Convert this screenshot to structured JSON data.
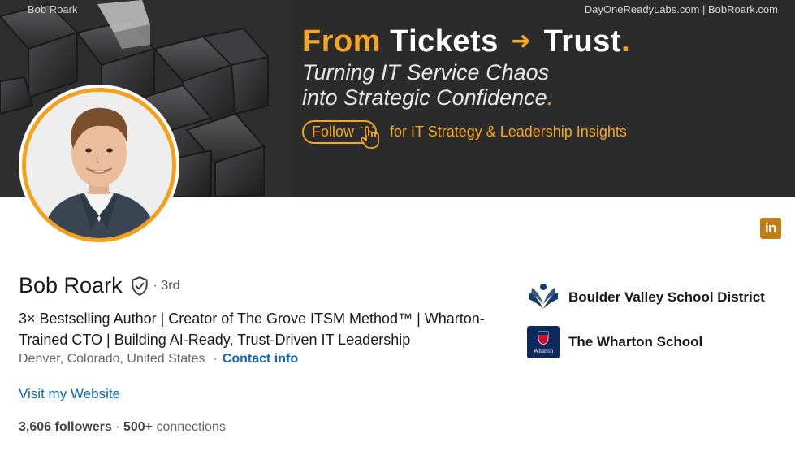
{
  "banner": {
    "owner": "Bob Roark",
    "site": "DayOneReadyLabs.com | BobRoark.com",
    "headline_part1": "From",
    "headline_part2": "Tickets",
    "headline_part3": "Trust",
    "headline_period": ".",
    "sub_line1": "Turning IT Service Chaos",
    "sub_line2": "into Strategic Confidence",
    "sub_period": ".",
    "follow_label": "Follow",
    "cta_text": "for IT Strategy & Leadership Insights",
    "accent_color": "#f5a623"
  },
  "profile": {
    "name": "Bob Roark",
    "degree": "· 3rd",
    "headline": "3× Bestselling Author | Creator of The Grove ITSM Method™ | Wharton-Trained CTO | Building AI-Ready, Trust-Driven IT Leadership",
    "location": "Denver, Colorado, United States",
    "contact_sep": "·",
    "contact_label": "Contact info",
    "website_label": "Visit my Website",
    "followers_count": "3,606 followers",
    "connections_sep": "·",
    "connections_count": "500+",
    "connections_label": "connections"
  },
  "orgs": [
    {
      "name": "Boulder Valley School District",
      "icon": "bvsd-logo"
    },
    {
      "name": "The Wharton School",
      "icon": "wharton-logo",
      "logo_text": "Wharton"
    }
  ],
  "badge": {
    "text": "in"
  }
}
